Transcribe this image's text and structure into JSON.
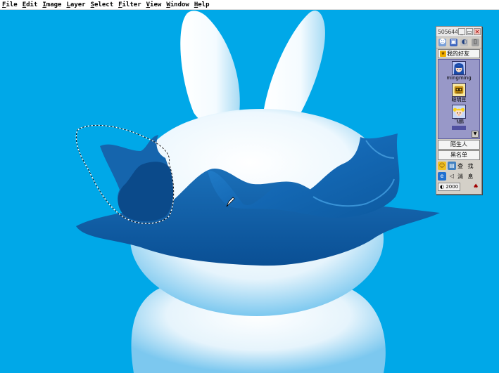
{
  "menu": {
    "items": [
      "File",
      "Edit",
      "Image",
      "Layer",
      "Select",
      "Filter",
      "View",
      "Window",
      "Help"
    ]
  },
  "canvas": {
    "background_color": "#00a8e8"
  },
  "qq": {
    "title": "505644",
    "minimize_label": "_",
    "restore_label": "▭",
    "close_label": "✕",
    "toolbar_icons": [
      "users-icon",
      "folder-icon",
      "globe-icon",
      "trash-icon"
    ],
    "group_header": "我的好友",
    "friends": [
      {
        "name": "mingming",
        "avatar": "anime-girl-avatar"
      },
      {
        "name": "聪明豆",
        "avatar": "robot-avatar"
      },
      {
        "name": "飞鹏",
        "avatar": "blonde-girl-avatar"
      }
    ],
    "strangers_label": "陌生人",
    "blacklist_label": "黑名单",
    "search_label": "查 找",
    "message_label": "消 息",
    "start_label": "2000"
  }
}
